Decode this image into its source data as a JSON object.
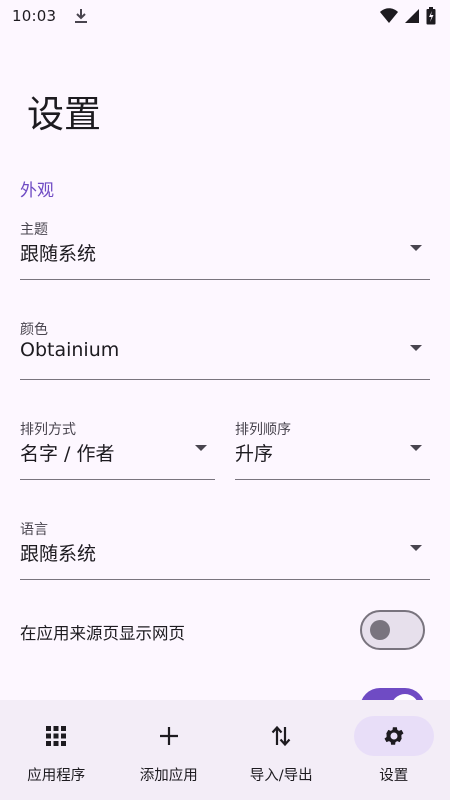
{
  "status_bar": {
    "time": "10:03"
  },
  "page": {
    "title": "设置"
  },
  "appearance": {
    "section_title": "外观",
    "theme": {
      "label": "主题",
      "value": "跟随系统"
    },
    "color": {
      "label": "颜色",
      "value": "Obtainium"
    },
    "sort_by": {
      "label": "排列方式",
      "value": "名字 / 作者"
    },
    "sort_order": {
      "label": "排列顺序",
      "value": "升序"
    },
    "language": {
      "label": "语言",
      "value": "跟随系统"
    }
  },
  "toggles": [
    {
      "label": "在应用来源页显示网页",
      "on": false
    },
    {
      "label": "",
      "on": true
    }
  ],
  "bottom_nav": [
    {
      "label": "应用程序",
      "icon": "apps-grid-icon",
      "active": false
    },
    {
      "label": "添加应用",
      "icon": "add-icon",
      "active": false
    },
    {
      "label": "导入/导出",
      "icon": "import-export-icon",
      "active": false
    },
    {
      "label": "设置",
      "icon": "settings-gear-icon",
      "active": true
    }
  ],
  "colors": {
    "accent": "#6f4bc4",
    "background": "#fdf7ff",
    "nav_background": "#f3edf7",
    "indicator": "#e8def8"
  }
}
